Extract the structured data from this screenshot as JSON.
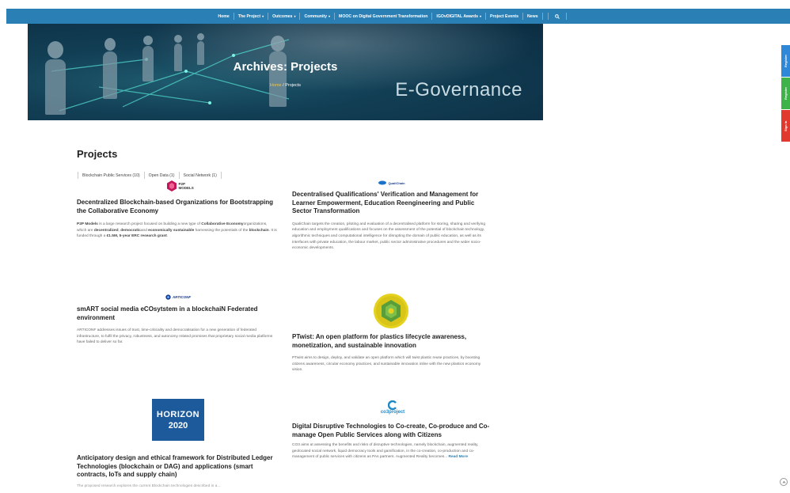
{
  "nav": {
    "items": [
      {
        "label": "Home",
        "dropdown": false
      },
      {
        "label": "The Project",
        "dropdown": true
      },
      {
        "label": "Outcomes",
        "dropdown": true
      },
      {
        "label": "Community",
        "dropdown": true
      },
      {
        "label": "MOOC on Digital Government Transformation",
        "dropdown": false
      },
      {
        "label": "IGOvDIGITAL Awards",
        "dropdown": true
      },
      {
        "label": "Project Events",
        "dropdown": false
      },
      {
        "label": "News",
        "dropdown": false
      }
    ],
    "caret": "▾",
    "search_icon": "search-icon"
  },
  "hero": {
    "title": "Archives: Projects",
    "breadcrumb_home": "Home",
    "breadcrumb_sep": "/",
    "breadcrumb_current": "Projects",
    "banner_text": "E-Governance"
  },
  "side_tabs": [
    {
      "label": "Register",
      "color": "#2f87d8"
    },
    {
      "label": "Register",
      "color": "#3db34a"
    },
    {
      "label": "Sign in",
      "color": "#e2392f"
    }
  ],
  "main": {
    "title": "Projects",
    "filters": [
      "Blockchain Public Services (10)",
      "Open Data (1)",
      "Social Network (1)"
    ]
  },
  "projects": [
    {
      "logo": "P2P MODELS",
      "title": "Decentralized Blockchain-based Organizations for Bootstrapping the Collaborative Economy",
      "desc_parts": [
        {
          "b": "P2P Models"
        },
        {
          "t": " is a large research project focused on building a new type of "
        },
        {
          "b": "Collaborative Economy"
        },
        {
          "t": "organizations, which are "
        },
        {
          "b": "decentralized"
        },
        {
          "t": ", "
        },
        {
          "b": "democratic"
        },
        {
          "t": "and "
        },
        {
          "b": "economically sustainable"
        },
        {
          "t": " harnessing the potentials of the "
        },
        {
          "b": "blockchain"
        },
        {
          "t": ". It is funded through a "
        },
        {
          "b": "€1.5M, 5-year ERC research grant"
        },
        {
          "t": "."
        }
      ]
    },
    {
      "logo": "QualiChain",
      "title": "Decentralised Qualifications' Verification and Management for Learner Empowerment, Education Reengineering and Public Sector Transformation",
      "desc": "QualiChain targets the creation, piloting and evaluation of a decentralised platform for storing, sharing and verifying education and employment qualifications and focuses on the assessment of the potential of blockchain technology, algorithmic techniques and computational intelligence for disrupting the domain of public education, as well as its interfaces with private education, the labour market, public sector administrative procedures and the wider socio-economic developments."
    },
    {
      "logo": "ARTICONF",
      "title": "smART social media eCOsytstem in a blockchaiN Federated environment",
      "desc": "ARTICONF addresses issues of trust, time-criticality and democratisation for a new generation of federated infrastructure, to fulfil the privacy, robustness, and autonomy related promises that proprietary social media platforms have failed to deliver so far."
    },
    {
      "logo": "PTwist",
      "title": "PTwist: An open platform for plastics lifecycle awareness, monetization, and sustainable innovation",
      "desc": "PTwist aims to design, deploy, and validate an open platform which will twist plastic reuse practices, by boosting citizens awareness, circular economy practices, and sustainable innovation inline with the new plastics economy vision."
    },
    {
      "logo_line1": "HORIZON",
      "logo_line2": "2020",
      "title": "Anticipatory design and ethical framework for Distributed Ledger Technologies (blockchain or DAG) and applications (smart contracts, IoTs and supply chain)",
      "desc": "The proposed research explores the current Blockchain technologies described in a..."
    },
    {
      "logo": "co3project",
      "title": "Digital Disruptive Technologies to Co-create, Co-produce and Co-manage Open Public Services along with Citizens",
      "desc": "CO3 aims at assessing the benefits and risks of disruptive technologies, namely blockchain, augmented reality, geolocated social network, liquid democracy tools and gamification, in the co-creation, co-production and co-management of public services with citizens as PAs partners. Augmented Reality becomes...",
      "read_more": "Read More"
    }
  ],
  "colors": {
    "nav_bg": "#2a7fb4",
    "accent": "#f5c542",
    "horizon_bg": "#1c5a9c"
  }
}
